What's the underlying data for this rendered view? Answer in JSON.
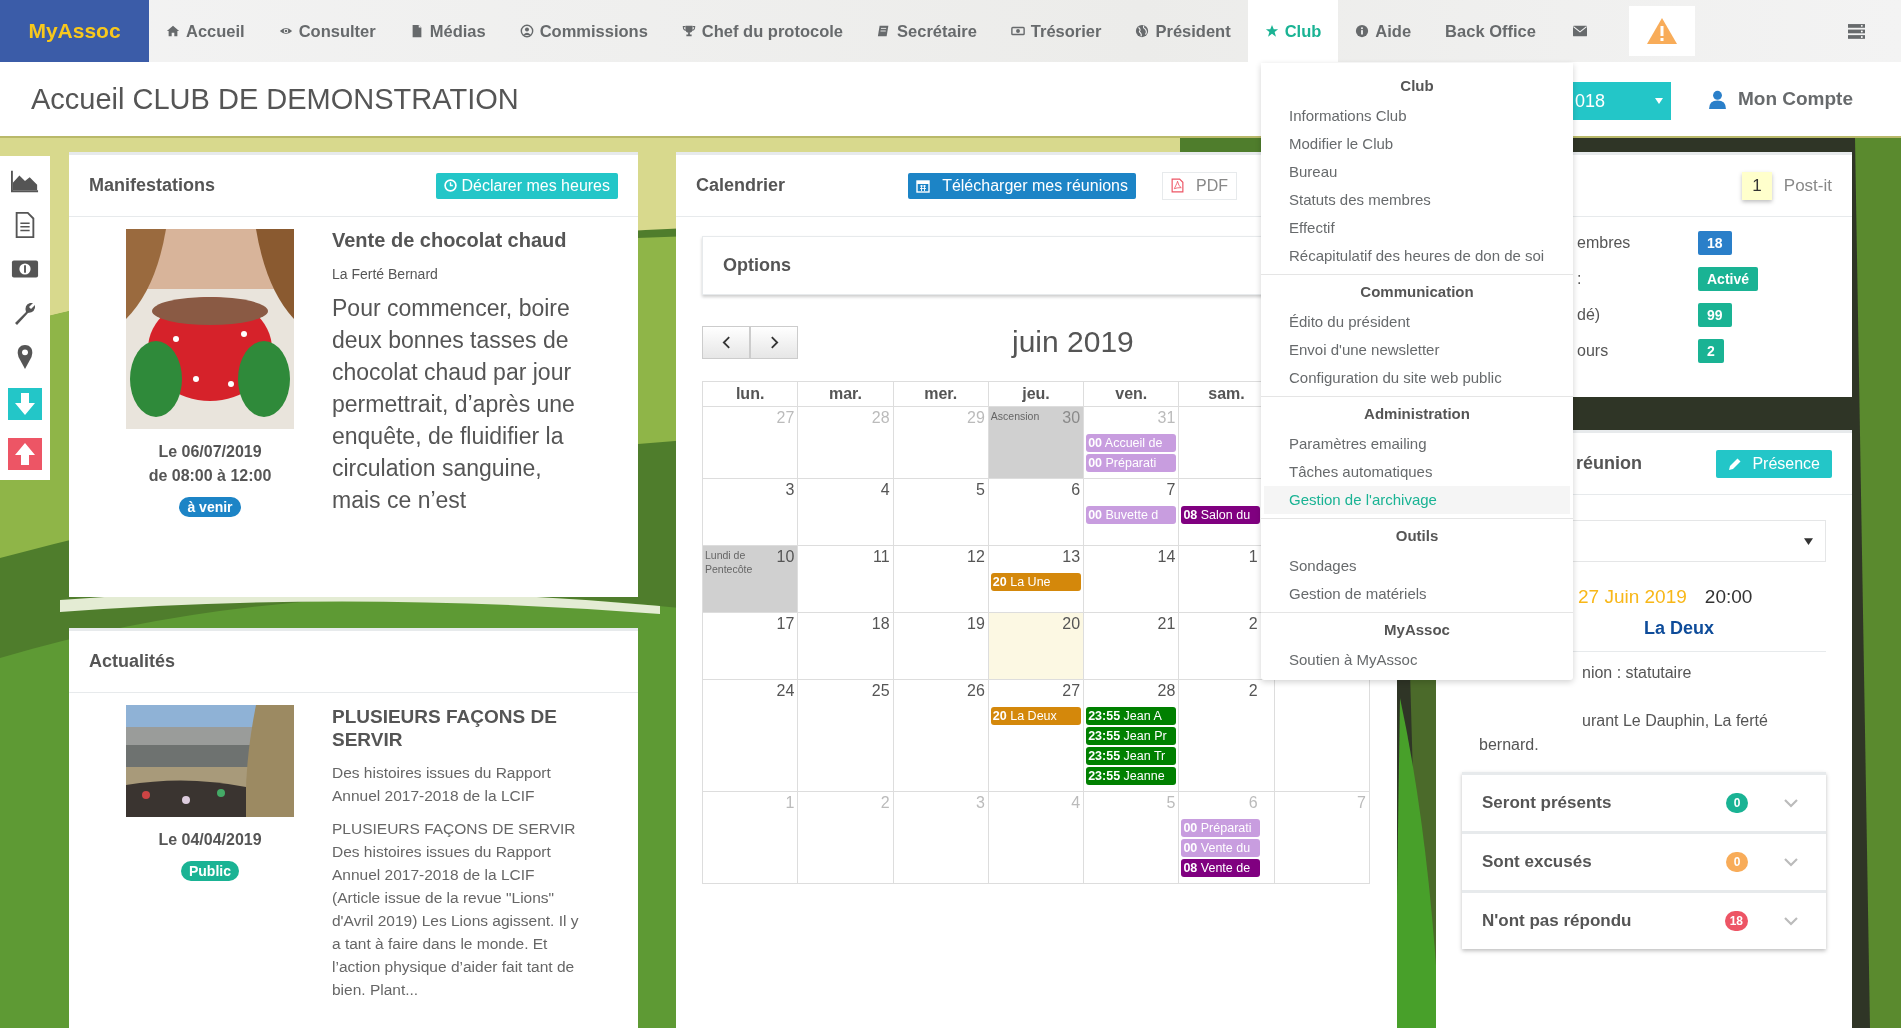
{
  "nav": {
    "logo": "MyAssoc",
    "items": [
      {
        "label": "Accueil",
        "selected": false
      },
      {
        "label": "Consulter",
        "selected": false
      },
      {
        "label": "Médias",
        "selected": false
      },
      {
        "label": "Commissions",
        "selected": false
      },
      {
        "label": "Chef du protocole",
        "selected": false
      },
      {
        "label": "Secrétaire",
        "selected": false
      },
      {
        "label": "Trésorier",
        "selected": false
      },
      {
        "label": "Président",
        "selected": false
      },
      {
        "label": "Club",
        "selected": true
      },
      {
        "label": "Aide",
        "selected": false
      },
      {
        "label": "Back Office",
        "selected": false
      }
    ]
  },
  "header": {
    "title": "Accueil CLUB DE DEMONSTRATION",
    "year_select": "018",
    "account": "Mon Compte"
  },
  "dropdown": {
    "sections": [
      {
        "heading": "Club",
        "items": [
          {
            "label": "Informations Club",
            "selected": false
          },
          {
            "label": "Modifier le Club",
            "selected": false
          },
          {
            "label": "Bureau",
            "selected": false
          },
          {
            "label": "Statuts des membres",
            "selected": false
          },
          {
            "label": "Effectif",
            "selected": false
          },
          {
            "label": "Récapitulatif des heures de don de soi",
            "selected": false
          }
        ]
      },
      {
        "heading": "Communication",
        "items": [
          {
            "label": "Édito du président",
            "selected": false
          },
          {
            "label": "Envoi d'une newsletter",
            "selected": false
          },
          {
            "label": "Configuration du site web public",
            "selected": false
          }
        ]
      },
      {
        "heading": "Administration",
        "items": [
          {
            "label": "Paramètres emailing",
            "selected": false
          },
          {
            "label": "Tâches automatiques",
            "selected": false
          },
          {
            "label": "Gestion de l'archivage",
            "selected": true
          }
        ]
      },
      {
        "heading": "Outils",
        "items": [
          {
            "label": "Sondages",
            "selected": false
          },
          {
            "label": "Gestion de matériels",
            "selected": false
          }
        ]
      },
      {
        "heading": "MyAssoc",
        "items": [
          {
            "label": "Soutien à MyAssoc",
            "selected": false
          }
        ]
      }
    ]
  },
  "manifestations": {
    "title": "Manifestations",
    "button": "Déclarer mes heures",
    "event": {
      "date": "Le 06/07/2019",
      "time": "de 08:00 à 12:00",
      "status": "à venir",
      "name": "Vente de chocolat chaud",
      "place": "La Ferté Bernard",
      "description": "Pour commencer, boire deux bonnes tasses de chocolat chaud par jour permettrait, d’après une enquête, de fluidifier la circulation sanguine, mais ce n’est"
    }
  },
  "news": {
    "title": "Actualités",
    "article": {
      "date": "Le 04/04/2019",
      "visibility": "Public",
      "headline": "PLUSIEURS FAÇONS DE SERVIR",
      "summary": "Des histoires issues du Rapport Annuel 2017-2018 de la LCIF",
      "body": "PLUSIEURS FAÇONS DE SERVIR Des histoires issues du Rapport Annuel 2017-2018 de la LCIF (Article issue de la revue \"Lions\" d'Avril 2019)   Les Lions agissent. Il y a tant à faire dans le monde. Et l’action physique d’aider fait tant de bien. Plant..."
    }
  },
  "calendar": {
    "title": "Calendrier",
    "download_button": "Télécharger mes réunions",
    "pdf_button": "PDF",
    "options": "Options",
    "month": "juin 2019",
    "weekdays": [
      "lun.",
      "mar.",
      "mer.",
      "jeu.",
      "ven.",
      "sam."
    ],
    "weeks": [
      [
        {
          "day": "27",
          "other_month": true,
          "today": false
        },
        {
          "day": "28",
          "other_month": true,
          "today": false
        },
        {
          "day": "29",
          "other_month": true,
          "today": false
        },
        {
          "day": "30",
          "other_month": true,
          "today": false,
          "holiday": "Ascension"
        },
        {
          "day": "31",
          "other_month": true,
          "today": false,
          "events": [
            {
              "time": "00",
              "title": "Accueil de",
              "color": "#c89ddf"
            },
            {
              "time": "00",
              "title": "Préparati",
              "color": "#c89ddf"
            }
          ]
        }
      ],
      [
        {
          "day": "3",
          "other_month": false,
          "today": false
        },
        {
          "day": "4",
          "other_month": false,
          "today": false
        },
        {
          "day": "5",
          "other_month": false,
          "today": false
        },
        {
          "day": "6",
          "other_month": false,
          "today": false
        },
        {
          "day": "7",
          "other_month": false,
          "today": false,
          "events": [
            {
              "time": "00",
              "title": "Buvette d",
              "color": "#c89ddf"
            }
          ]
        },
        {
          "events": [
            {
              "time": "08",
              "title": "Salon du",
              "color": "#800080"
            }
          ]
        }
      ],
      [
        {
          "day": "10",
          "other_month": false,
          "today": false,
          "holiday": "Lundi de Pentecôte"
        },
        {
          "day": "11",
          "other_month": false,
          "today": false
        },
        {
          "day": "12",
          "other_month": false,
          "today": false
        },
        {
          "day": "13",
          "other_month": false,
          "today": false,
          "events": [
            {
              "time": "20",
              "title": "La Une",
              "color": "#d4880b"
            }
          ]
        },
        {
          "day": "14",
          "other_month": false,
          "today": false
        },
        {
          "day": "1",
          "other_month": false,
          "today": false
        }
      ],
      [
        {
          "day": "17",
          "other_month": false,
          "today": false
        },
        {
          "day": "18",
          "other_month": false,
          "today": false
        },
        {
          "day": "19",
          "other_month": false,
          "today": false
        },
        {
          "day": "20",
          "other_month": false,
          "today": true
        },
        {
          "day": "21",
          "other_month": false,
          "today": false
        },
        {
          "day": "2",
          "other_month": false,
          "today": false
        }
      ],
      [
        {
          "day": "24",
          "other_month": false,
          "today": false
        },
        {
          "day": "25",
          "other_month": false,
          "today": false
        },
        {
          "day": "26",
          "other_month": false,
          "today": false
        },
        {
          "day": "27",
          "other_month": false,
          "today": false,
          "events": [
            {
              "time": "20",
              "title": "La Deux",
              "color": "#d4880b"
            }
          ]
        },
        {
          "day": "28",
          "other_month": false,
          "today": false,
          "events": [
            {
              "time": "23:55",
              "title": "Jean A",
              "color": "#008000"
            },
            {
              "time": "23:55",
              "title": "Jean Pr",
              "color": "#008000"
            },
            {
              "time": "23:55",
              "title": "Jean Tr",
              "color": "#008000"
            },
            {
              "time": "23:55",
              "title": "Jeanne",
              "color": "#008000"
            }
          ]
        },
        {
          "day": "2",
          "other_month": false,
          "today": false
        }
      ],
      [
        {
          "day": "1",
          "other_month": true,
          "today": false
        },
        {
          "day": "2",
          "other_month": true,
          "today": false
        },
        {
          "day": "3",
          "other_month": true,
          "today": false
        },
        {
          "day": "4",
          "other_month": true,
          "today": false
        },
        {
          "day": "5",
          "other_month": true,
          "today": false
        },
        {
          "day": "6",
          "other_month": true,
          "today": false,
          "events": [
            {
              "time": "00",
              "title": "Préparati",
              "color": "#c89ddf"
            },
            {
              "time": "00",
              "title": "Vente du",
              "color": "#c89ddf"
            },
            {
              "time": "08",
              "title": "Vente de",
              "color": "#800080"
            }
          ]
        },
        {
          "day": "7",
          "other_month": true,
          "today": false
        }
      ]
    ]
  },
  "postit": {
    "count": "1",
    "label": "Post-it",
    "stats": [
      {
        "label": "embres",
        "value": "18",
        "color": "#2a7fc9"
      },
      {
        "label": ":",
        "value": "Activé",
        "color": "#1ab394"
      },
      {
        "label": "dé)",
        "value": "99",
        "color": "#1ab394"
      },
      {
        "label": "ours",
        "value": "2",
        "color": "#1ab394"
      }
    ]
  },
  "meeting": {
    "title": "réunion",
    "button": "Présence",
    "date": "27 Juin 2019",
    "time": "20:00",
    "name": "La Deux",
    "type": "nion : statutaire",
    "address_line_1": "urant Le Dauphin, La ferté",
    "address_line_2": "bernard.",
    "responses": [
      {
        "label": "Seront présents",
        "count": "0",
        "color": "#1ab394"
      },
      {
        "label": "Sont excusés",
        "count": "0",
        "color": "#f8ac59"
      },
      {
        "label": "N'ont pas répondu",
        "count": "18",
        "color": "#ed5565"
      }
    ]
  }
}
